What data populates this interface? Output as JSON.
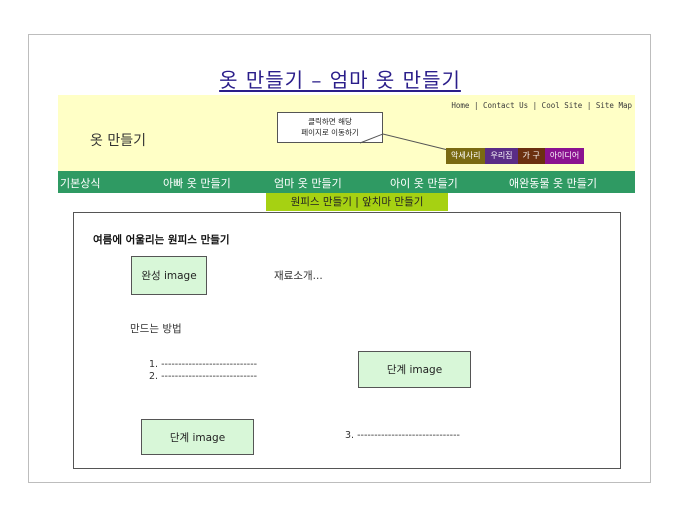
{
  "page": {
    "title": "옷 만들기 – 엄마 옷 만들기"
  },
  "header": {
    "site_name": "옷 만들기",
    "top_links": "Home | Contact Us |  Cool Site  | Site Map",
    "callout_line1": "클릭하면 해당",
    "callout_line2": "페이지로 이동하기",
    "tabs": [
      {
        "label": "악세사리",
        "color": "#7a6a12"
      },
      {
        "label": "우리집",
        "color": "#5a2d86"
      },
      {
        "label": "가 구",
        "color": "#6b3010"
      },
      {
        "label": "아이디어",
        "color": "#8a1290"
      }
    ]
  },
  "nav": {
    "items": [
      "기본상식",
      "아빠 옷 만들기",
      "엄마 옷 만들기",
      "아이 옷 만들기",
      "애완동물 옷 만들기"
    ],
    "sub": "원피스 만들기 | 앞치마 만들기"
  },
  "content": {
    "section_title": "여름에 어울리는 원피스 만들기",
    "complete_image": "완성 image",
    "materials": "재료소개...",
    "method": "만드는 방법",
    "step1": "1.  ----------------------------",
    "step2": "2.  ----------------------------",
    "step_image_1": "단계 image",
    "step_image_2": "단계 image",
    "step3": "3. ------------------------------"
  },
  "colors": {
    "nav_bar": "#2f9a63",
    "sub_nav": "#a6d112",
    "header_bg": "#ffffc6",
    "image_box": "#d8f7d8",
    "title": "#2a1d8a"
  }
}
